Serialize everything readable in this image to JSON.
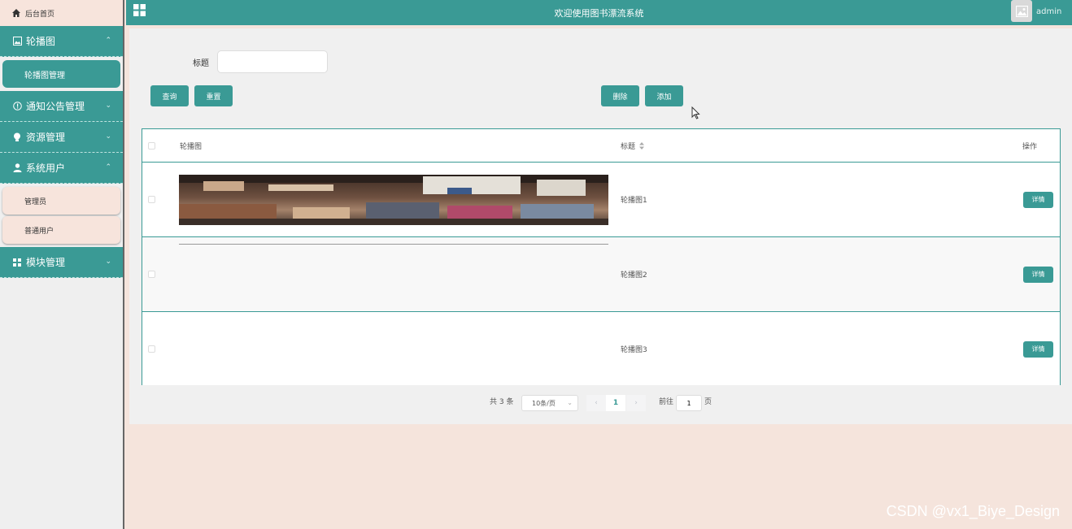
{
  "sidebar": {
    "home_label": "后台首页",
    "groups": [
      {
        "label": "轮播图",
        "chevron": "⌃"
      },
      {
        "label": "通知公告管理",
        "chevron": "⌄"
      },
      {
        "label": "资源管理",
        "chevron": "⌄"
      },
      {
        "label": "系统用户",
        "chevron": "⌃"
      },
      {
        "label": "模块管理",
        "chevron": "⌄"
      }
    ],
    "carousel_sub": "轮播图管理",
    "user_subs": [
      "管理员",
      "普通用户"
    ]
  },
  "topbar": {
    "title": "欢迎使用图书漂流系统",
    "username": "admin"
  },
  "search": {
    "label": "标题",
    "value": ""
  },
  "toolbar": {
    "query_label": "查询",
    "reset_label": "重置",
    "delete_label": "删除",
    "add_label": "添加"
  },
  "table": {
    "headers": [
      "轮播图",
      "标题",
      "操作"
    ],
    "rows": [
      {
        "title": "轮播图1",
        "action": "详情"
      },
      {
        "title": "轮播图2",
        "action": "详情"
      },
      {
        "title": "轮播图3",
        "action": "详情"
      }
    ]
  },
  "pagination": {
    "total_text": "共 3 条",
    "page_size": "10条/页",
    "current_page": "1",
    "goto_prefix": "前往",
    "goto_value": "1",
    "goto_suffix": "页"
  },
  "watermark": "CSDN @vx1_Biye_Design",
  "colors": {
    "accent": "#3a9a95",
    "background": "#f5e4dc"
  }
}
